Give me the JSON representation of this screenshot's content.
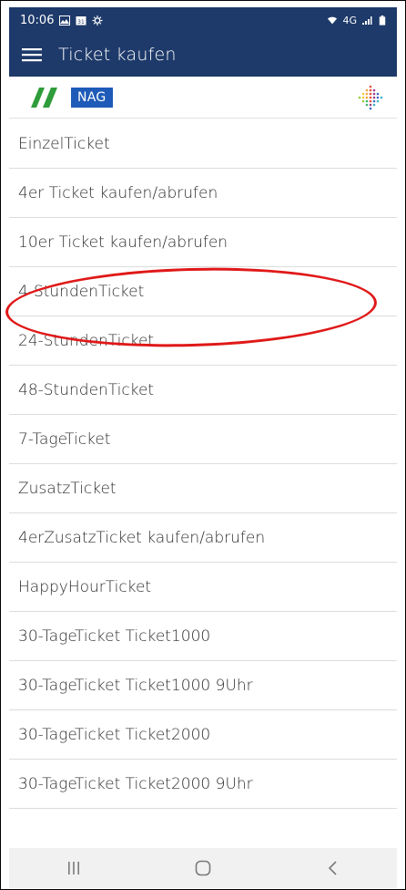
{
  "status": {
    "time": "10:06",
    "network": "4G"
  },
  "appbar": {
    "title": "Ticket kaufen"
  },
  "brand": {
    "logo_text": "NAG"
  },
  "tickets": [
    "EinzelTicket",
    "4er Ticket kaufen/abrufen",
    "10er Ticket kaufen/abrufen",
    "4-StundenTicket",
    "24-StundenTicket",
    "48-StundenTicket",
    "7-TageTicket",
    "ZusatzTicket",
    "4erZusatzTicket kaufen/abrufen",
    "HappyHourTicket",
    "30-TageTicket Ticket1000",
    "30-TageTicket Ticket1000 9Uhr",
    "30-TageTicket Ticket2000",
    "30-TageTicket Ticket2000 9Uhr"
  ],
  "colors": {
    "appbar": "#1e3a6a",
    "highlight_circle": "#e01818",
    "nag_blue": "#1e5bb8",
    "stripe_green": "#2e9c3a"
  },
  "highlighted_item": "4-StundenTicket"
}
